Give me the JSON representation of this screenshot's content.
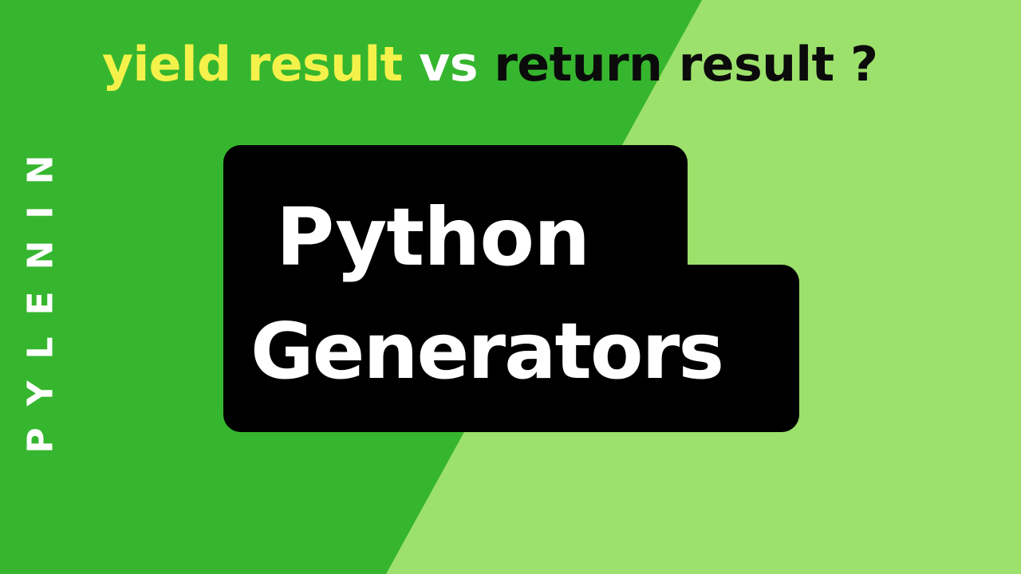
{
  "brand": {
    "vertical_text": "PYLENIN"
  },
  "headline": {
    "part_yield": "yield result",
    "part_vs": "vs",
    "part_return": "return result ?"
  },
  "title": {
    "line1": "Python",
    "line2": "Generators"
  },
  "colors": {
    "dark_green": "#36b62e",
    "light_green": "#9ce16b",
    "yellow": "#f4f24a",
    "black_box": "#000000",
    "white": "#ffffff"
  }
}
